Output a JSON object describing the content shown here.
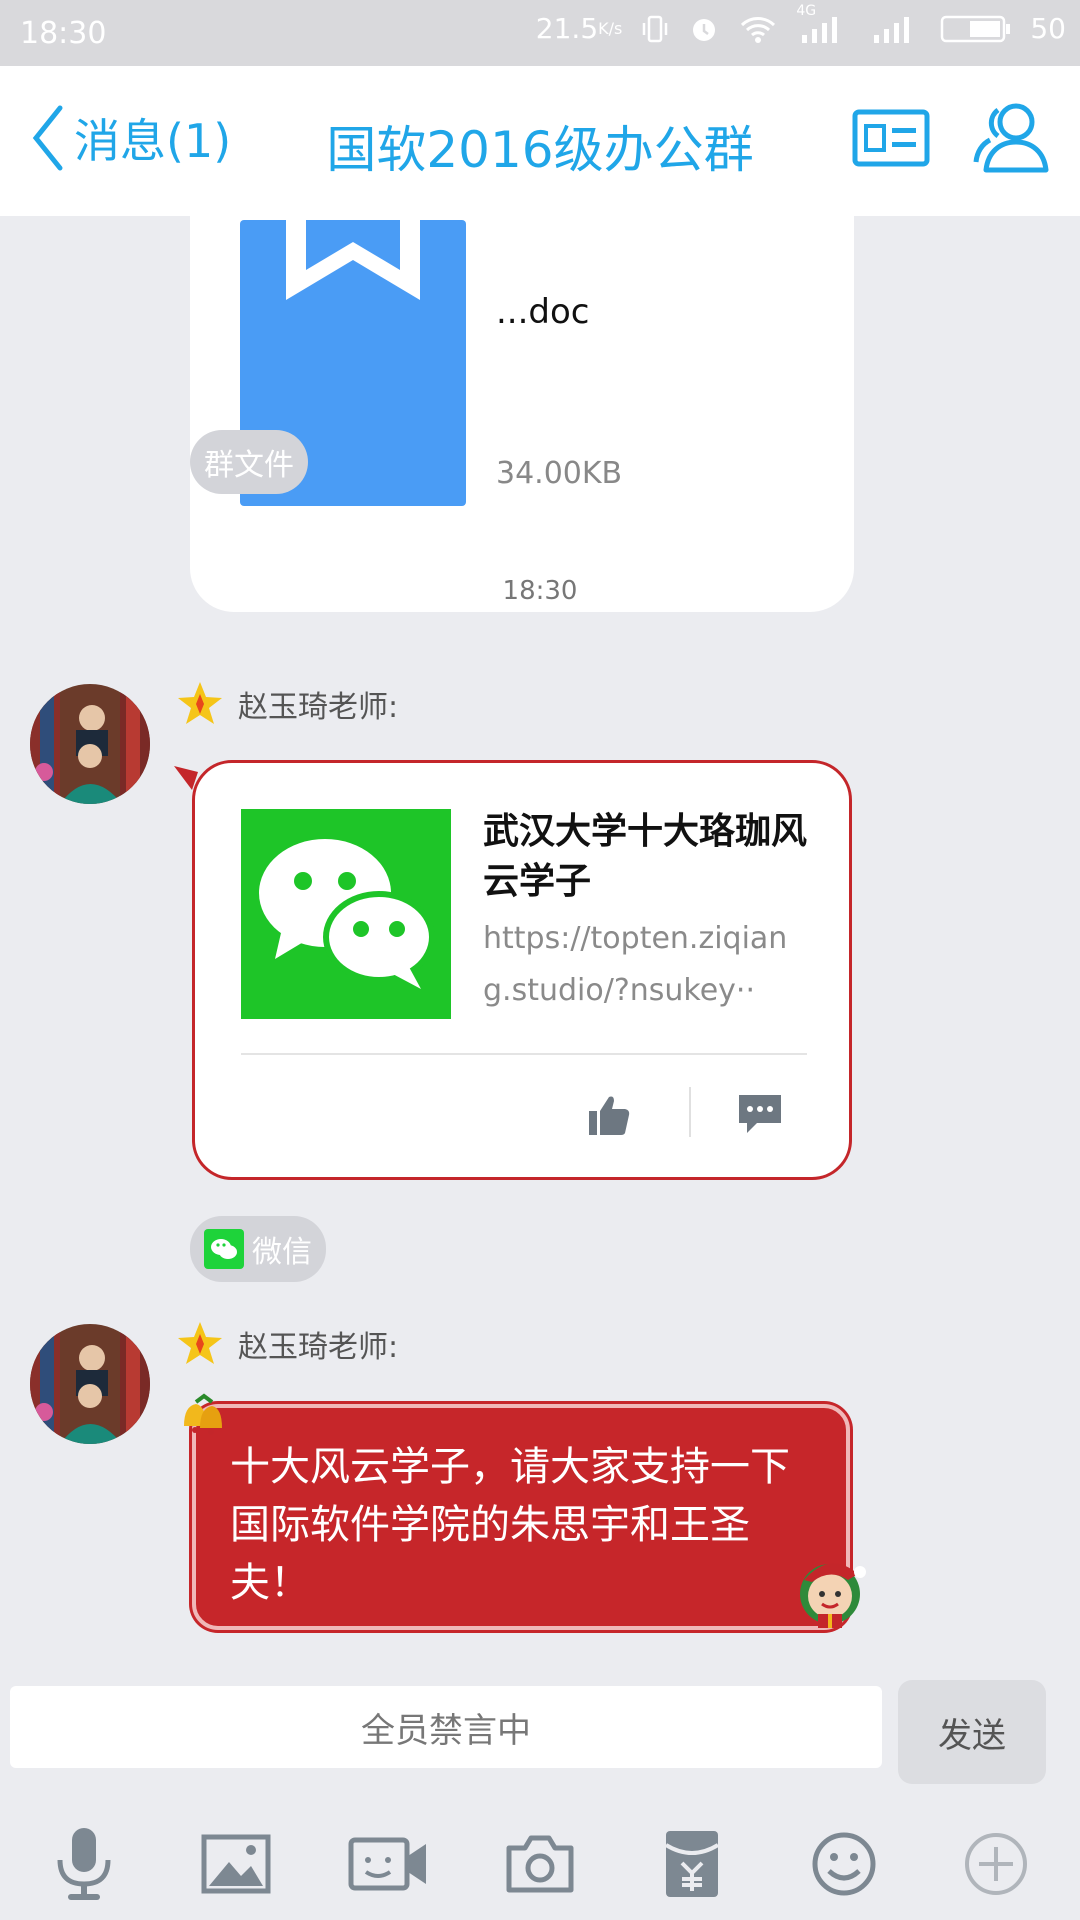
{
  "status_bar": {
    "time": "18:30",
    "net_speed": "21.5",
    "net_unit": "K/s",
    "network": "4G",
    "battery": "50"
  },
  "header": {
    "back_label": "消息(1)",
    "title": "国软2016级办公群"
  },
  "file_message": {
    "file_name": "...doc",
    "file_size": "34.00KB",
    "source_label": "群文件"
  },
  "timestamp": "18:30",
  "messages": [
    {
      "sender": "赵玉琦老师:",
      "link": {
        "title": "武汉大学十大珞珈风云学子",
        "url": "https://topten.ziqiang.studio/?nsukey··"
      },
      "source_label": "微信"
    },
    {
      "sender": "赵玉琦老师:",
      "text": "十大风云学子，请大家支持一下国际软件学院的朱思宇和王圣夫！"
    }
  ],
  "input": {
    "placeholder": "全员禁言中",
    "send_label": "发送"
  },
  "colors": {
    "accent": "#20a6e8",
    "bubble_red": "#c6262a",
    "wechat_green": "#1ec528",
    "doc_blue": "#4a9cf5"
  },
  "icons": [
    "microphone-icon",
    "image-icon",
    "video-call-icon",
    "camera-icon",
    "red-packet-icon",
    "emoji-icon",
    "plus-icon"
  ]
}
